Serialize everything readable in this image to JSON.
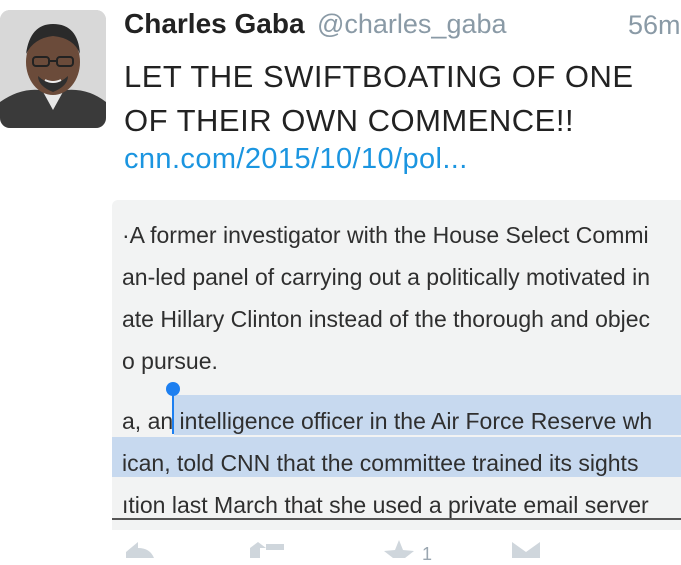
{
  "tweet": {
    "name": "Charles Gaba",
    "handle": "@charles_gaba",
    "time": "56m",
    "text": "LET THE SWIFTBOATING OF ONE OF THEIR OWN COMMENCE!!",
    "link": "cnn.com/2015/10/10/pol..."
  },
  "media": {
    "lines": [
      "·A former investigator with the House Select Commi",
      "an-led panel of carrying out a politically motivated in",
      "ate Hillary Clinton instead of the thorough and objec",
      "o pursue.",
      "a, an intelligence officer in the Air Force Reserve wh",
      "ican, told CNN that the committee trained its sights",
      "ıtion last March that she used a private email server"
    ]
  },
  "actions": {
    "retweet_count": "1"
  },
  "colors": {
    "link": "#1b95e0",
    "selection": "#c7d9ef",
    "caret": "#1d7ff0",
    "meta": "#8a9aa6"
  }
}
